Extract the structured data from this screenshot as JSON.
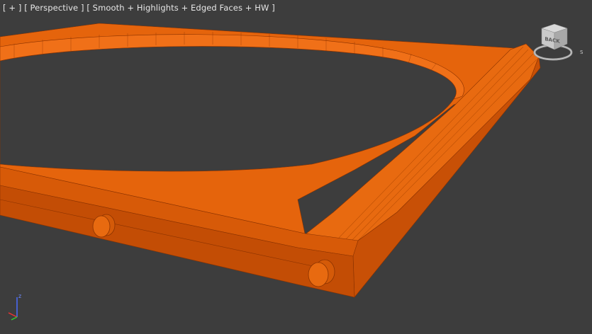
{
  "viewport": {
    "label_parts": [
      "[ + ]",
      "[ Perspective ]",
      "[ Smooth + Highlights + Edged Faces + HW ]"
    ]
  },
  "viewcube": {
    "face_label": "BACK"
  },
  "axis_tripod": {
    "z_label": "z"
  },
  "colors": {
    "background": "#3d3d3d",
    "model_top": "#e5640c",
    "model_side": "#c85006",
    "model_edge": "#8a3200",
    "hud_text": "#e6e6e6"
  }
}
